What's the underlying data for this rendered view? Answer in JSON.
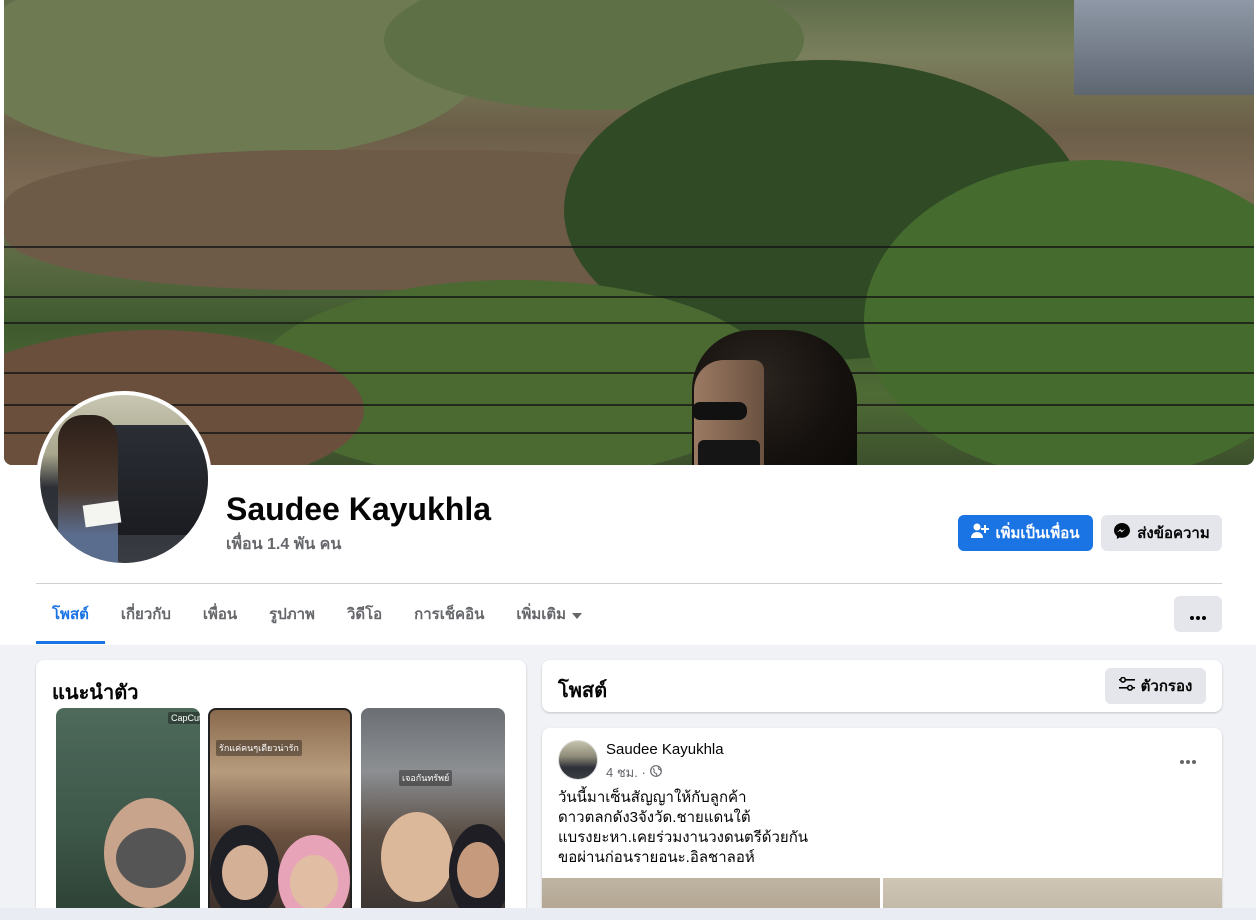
{
  "profile": {
    "name": "Saudee Kayukhla",
    "friends_count": "เพื่อน 1.4 พัน คน"
  },
  "actions": {
    "add_friend_label": "เพิ่มเป็นเพื่อน",
    "message_label": "ส่งข้อความ"
  },
  "tabs": [
    {
      "label": "โพสต์",
      "active": true
    },
    {
      "label": "เกี่ยวกับ",
      "active": false
    },
    {
      "label": "เพื่อน",
      "active": false
    },
    {
      "label": "รูปภาพ",
      "active": false
    },
    {
      "label": "วิดีโอ",
      "active": false
    },
    {
      "label": "การเช็คอิน",
      "active": false
    },
    {
      "label": "เพิ่มเติม",
      "active": false
    }
  ],
  "more_menu_icon": "ellipsis-icon",
  "intro": {
    "title": "แนะนำตัว",
    "stories": [
      {
        "caption": "CapCut"
      },
      {
        "caption": "รักแค่คนๆเดียวน่ารัก"
      },
      {
        "caption": "เจอกันทรัพย์"
      }
    ]
  },
  "posts_section": {
    "title": "โพสต์",
    "filter_label": "ตัวกรอง"
  },
  "post": {
    "author": "Saudee Kayukhla",
    "time": "4 ชม. ·",
    "privacy_icon": "globe-icon",
    "lines": [
      "วันนี้มาเซ็นสัญญาให้กับลูกค้า",
      "ดาวตลกดัง3จังวัด.ชายแดนใต้",
      "แบรงยะหา.เคยร่วมงานวงดนตรีด้วยกัน",
      "ขอผ่านก่อนรายอนะ.อิลชาลอห์"
    ]
  },
  "colors": {
    "accent": "#1b74e4",
    "page_bg": "#f0f2f5",
    "secondary_button": "#e4e6eb",
    "muted_text": "#65676b"
  }
}
